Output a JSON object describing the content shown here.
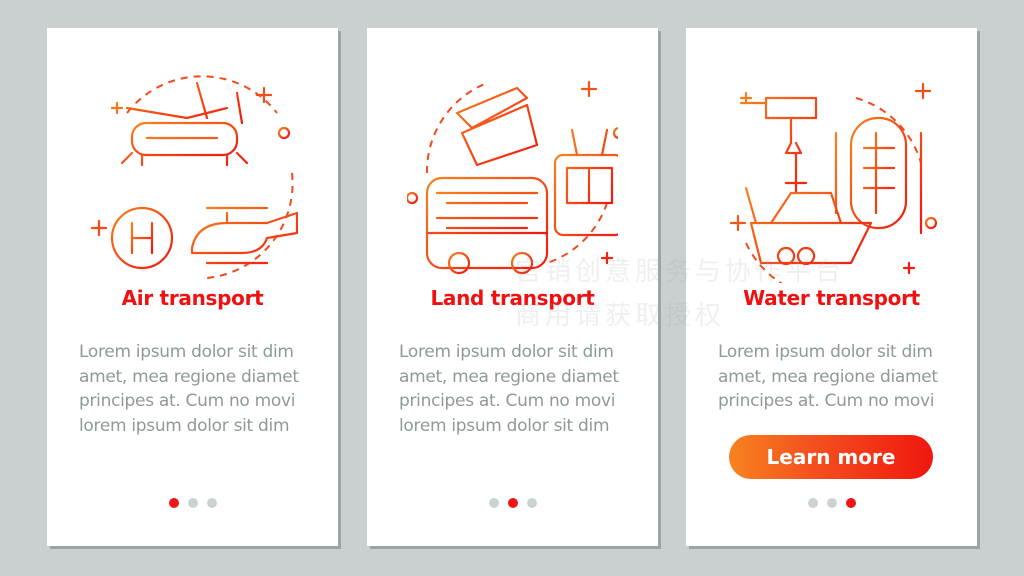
{
  "colors": {
    "accent": "#f01010",
    "text": "#8e9a99",
    "background": "#c9d0cf",
    "button_start": "#f7831f",
    "button_end": "#f0170f",
    "dot_inactive": "#ccd2d2"
  },
  "cards": [
    {
      "title": "Air transport",
      "icon": "helicopter-icon",
      "body": "Lorem ipsum dolor sit dim amet, mea regione diamet principes at. Cum no movi lorem ipsum dolor sit dim",
      "active_dot": 0
    },
    {
      "title": "Land transport",
      "icon": "bus-icon",
      "body": "Lorem ipsum dolor sit dim amet, mea regione diamet principes at. Cum no movi lorem ipsum dolor sit dim",
      "active_dot": 1
    },
    {
      "title": "Water transport",
      "icon": "boat-icon",
      "body": "Lorem ipsum dolor sit dim amet, mea regione diamet principes at. Cum no movi",
      "active_dot": 2,
      "button": "Learn more"
    }
  ],
  "watermark": {
    "line1": "宫销创意服务与协作平台",
    "line2": "商用请获取授权"
  }
}
